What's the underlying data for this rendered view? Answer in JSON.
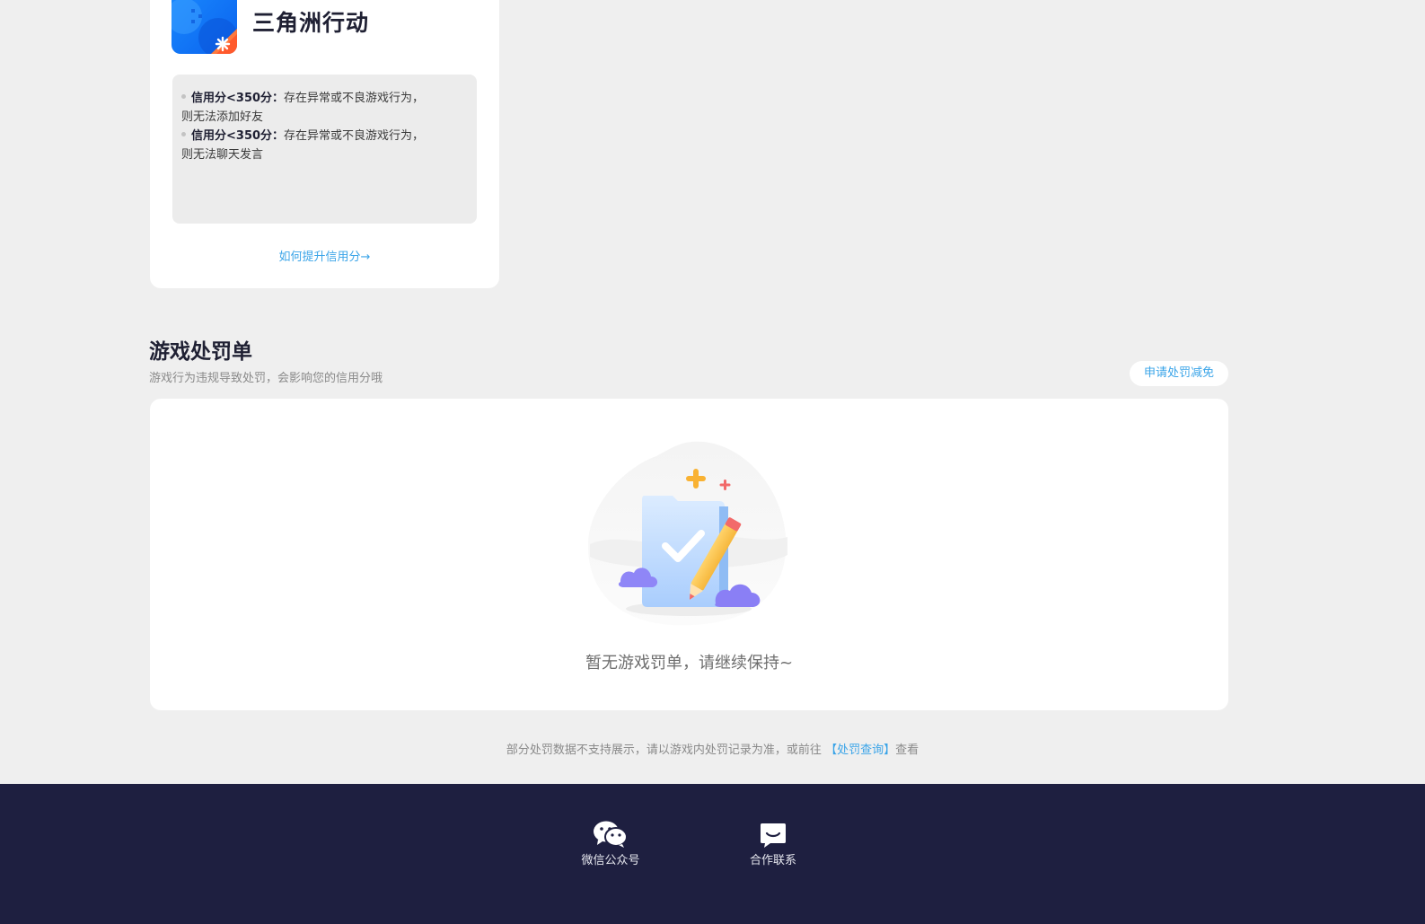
{
  "game": {
    "name": "三角洲行动"
  },
  "rules": [
    {
      "label": "信用分<350分：",
      "text_line1": "存在异常或不良游戏行为，",
      "text_line2": "则无法添加好友"
    },
    {
      "label": "信用分<350分：",
      "text_line1": "存在异常或不良游戏行为，",
      "text_line2": "则无法聊天发言"
    }
  ],
  "credit_link": "如何提升信用分→",
  "penalty": {
    "title": "游戏处罚单",
    "subtitle": "游戏行为违规导致处罚，会影响您的信用分哦",
    "apply_button": "申请处罚减免",
    "empty_text": "暂无游戏罚单，请继续保持~"
  },
  "notice": {
    "prefix": "部分处罚数据不支持展示，请以游戏内处罚记录为准，或前往",
    "link": "【处罚查询】",
    "suffix": "查看"
  },
  "footer": {
    "items": [
      {
        "label": "微信公众号",
        "icon": "wechat-icon"
      },
      {
        "label": "合作联系",
        "icon": "chat-bubble-icon"
      }
    ]
  },
  "colors": {
    "page_bg": "#efefef",
    "accent": "#3aa4e8",
    "footer_bg": "#1e1f40",
    "text_dark": "#1f2033"
  }
}
